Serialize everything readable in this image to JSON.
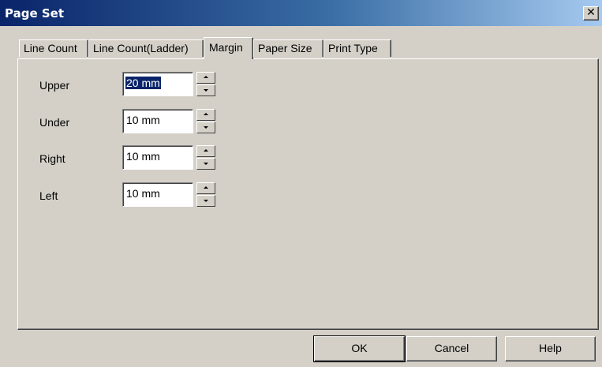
{
  "window": {
    "title": "Page Set",
    "close_glyph": "✕"
  },
  "tabs": [
    {
      "label": "Line Count",
      "active": false
    },
    {
      "label": "Line Count(Ladder)",
      "active": false
    },
    {
      "label": "Margin",
      "active": true
    },
    {
      "label": "Paper Size",
      "active": false
    },
    {
      "label": "Print Type",
      "active": false
    }
  ],
  "fields": [
    {
      "label": "Upper",
      "value": "20 mm",
      "selected": true
    },
    {
      "label": "Under",
      "value": "10 mm",
      "selected": false
    },
    {
      "label": "Right",
      "value": "10 mm",
      "selected": false
    },
    {
      "label": "Left",
      "value": "10 mm",
      "selected": false
    }
  ],
  "buttons": {
    "ok": "OK",
    "cancel": "Cancel",
    "help": "Help"
  }
}
